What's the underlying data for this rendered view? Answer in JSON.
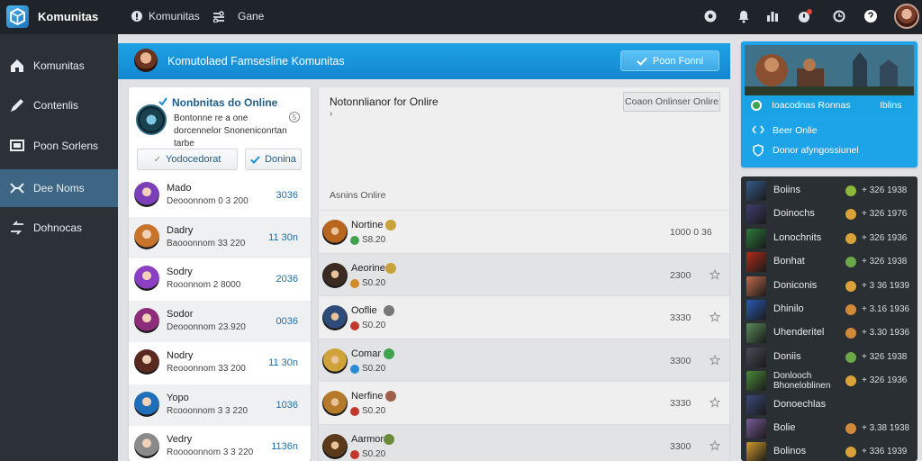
{
  "app": {
    "title": "Komunitas"
  },
  "top_nav": [
    {
      "label": "Komunitas",
      "icon": "bell-icon"
    },
    {
      "label": "Gane",
      "icon": "controller-icon"
    }
  ],
  "top_right_icons": [
    "settings-icon",
    "notification-icon",
    "trophy-icon",
    "alert-icon",
    "refresh-icon",
    "help-icon"
  ],
  "sidebar": {
    "items": [
      {
        "label": "Komunitas",
        "icon": "home-icon",
        "active": false
      },
      {
        "label": "Contenlis",
        "icon": "pen-icon",
        "active": false
      },
      {
        "label": "Poon Sorlens",
        "icon": "screen-icon",
        "active": false
      },
      {
        "label": "Dee Noms",
        "icon": "gamepad-icon",
        "active": true
      },
      {
        "label": "Dohnocas",
        "icon": "share-icon",
        "active": false
      }
    ]
  },
  "header_strip": {
    "title": "Komutolaed Famsesline Komunitas",
    "button_label": "Poon Fonni"
  },
  "profile_card": {
    "title": "Nonbnitas do Online",
    "description": "Bontonne re a one dorcennelor Snoneniconrtan tarbe",
    "info": "5",
    "button_primary": "Yodocedorat",
    "button_secondary": "Donina"
  },
  "players": [
    {
      "name": "Mado",
      "sub": "Deooonnom 0 3 200",
      "value": "3036",
      "color": "#7b3fb8"
    },
    {
      "name": "Dadry",
      "sub": "Baooonnom 33 220",
      "value": "11 30n",
      "color": "#c8742c"
    },
    {
      "name": "Sodry",
      "sub": "Rooonnom 2 8000",
      "value": "2036",
      "color": "#8b3fc2"
    },
    {
      "name": "Sodor",
      "sub": "Deooonnom 23.920",
      "value": "0036",
      "color": "#8c2c7a"
    },
    {
      "name": "Nodry",
      "sub": "Reooonnom 33 200",
      "value": "11 30n",
      "color": "#5a2a20"
    },
    {
      "name": "Yopo",
      "sub": "Rcooonnom 3 3 220",
      "value": "1036",
      "color": "#1e6fb8"
    },
    {
      "name": "Vedry",
      "sub": "Rooooonnom 3 3 220",
      "value": "1136n",
      "color": "#8a8a8a"
    }
  ],
  "middle": {
    "title": "Notonnlianor for Onlire",
    "caret": "›",
    "button_label": "Coaon Onlinser Onlire",
    "section_label": "Asnins Onlire"
  },
  "activity": [
    {
      "name": "Nortine",
      "sub": "S8.20",
      "value": "1000 0 36",
      "badge": "#c9a23a",
      "dot": "#3fa34d",
      "color": "#b8651e"
    },
    {
      "name": "Aeorine",
      "sub": "S0.20",
      "value": "2300",
      "badge": "#c9a23a",
      "dot": "#d08a2a",
      "color": "#3a2a22"
    },
    {
      "name": "Ooflie",
      "sub": "S0.20",
      "value": "3330",
      "badge": "#777",
      "dot": "#c0392b",
      "color": "#2e4b7a"
    },
    {
      "name": "Comar",
      "sub": "S0.20",
      "value": "3300",
      "badge": "#3fa34d",
      "dot": "#2a8ad4",
      "color": "#d0a33a"
    },
    {
      "name": "Nerfine",
      "sub": "S0.20",
      "value": "3330",
      "badge": "#a06048",
      "dot": "#c0392b",
      "color": "#b47a2a"
    },
    {
      "name": "Aarmor",
      "sub": "S0.20",
      "value": "3300",
      "badge": "#6a8a3a",
      "dot": "#c0392b",
      "color": "#5a3a1a"
    }
  ],
  "banner": {
    "label_1": "Ioacodnas Ronnas",
    "label_1_right": "Iblins",
    "label_2": "Beer Onlie",
    "label_3": "Donor afyngossiunel"
  },
  "ranking": [
    {
      "name": "Boiins",
      "value": "+ 326 1938",
      "color": "#355a8a",
      "coin": "#8ab83a"
    },
    {
      "name": "Doinochs",
      "value": "+ 326 1976",
      "color": "#3d3d70",
      "coin": "#d9a33a"
    },
    {
      "name": "Lonochnits",
      "value": "+ 326 1936",
      "color": "#2a7a3a",
      "coin": "#d9a33a"
    },
    {
      "name": "Bonhat",
      "value": "+ 326 1938",
      "color": "#b02a1a",
      "coin": "#6aa84a"
    },
    {
      "name": "Doniconis",
      "value": "+ 3 36 1939",
      "color": "#c06a4a",
      "coin": "#d9a33a"
    },
    {
      "name": "Dhinilo",
      "value": "+ 3.16 1936",
      "color": "#2a5ab8",
      "coin": "#d08a3a"
    },
    {
      "name": "Uhenderitel",
      "value": "+ 3.30 1936",
      "color": "#5a8a5a",
      "coin": "#d08a3a"
    },
    {
      "name": "Doniis",
      "value": "+ 326 1938",
      "color": "#4a4a5a",
      "coin": "#6aa84a"
    },
    {
      "name": "Donlooch Bhoneloblinen",
      "value": "+ 326 1936",
      "color": "#4a8a3a",
      "coin": "#d9a33a"
    },
    {
      "name": "Donoechlas",
      "value": "",
      "color": "#3a4a7a",
      "coin": "#2a2f34"
    },
    {
      "name": "Bolie",
      "value": "+ 3.38 1938",
      "color": "#7a5a9a",
      "coin": "#d08a3a"
    },
    {
      "name": "Bolinos",
      "value": "+ 336 1939",
      "color": "#d09a2a",
      "coin": "#d9a33a"
    }
  ]
}
